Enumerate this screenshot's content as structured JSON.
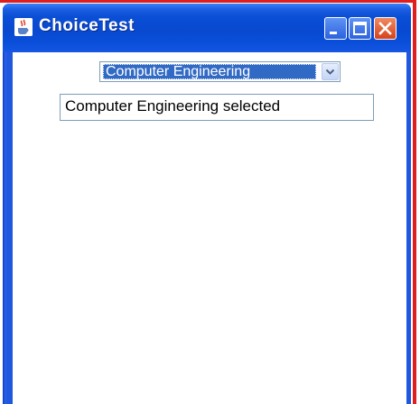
{
  "window": {
    "title": "ChoiceTest",
    "icon": "java-cup-icon",
    "controls": [
      "minimize-icon",
      "maximize-icon",
      "close-icon"
    ]
  },
  "choice": {
    "selected": "Computer Engineering",
    "arrow_icon": "chevron-down-icon"
  },
  "status_field": {
    "value": "Computer Engineering selected"
  },
  "colors": {
    "titlebar": "#0849d0",
    "selection": "#316ac5",
    "close_button": "#d6411c",
    "frame_accent": "#e01e1e"
  }
}
